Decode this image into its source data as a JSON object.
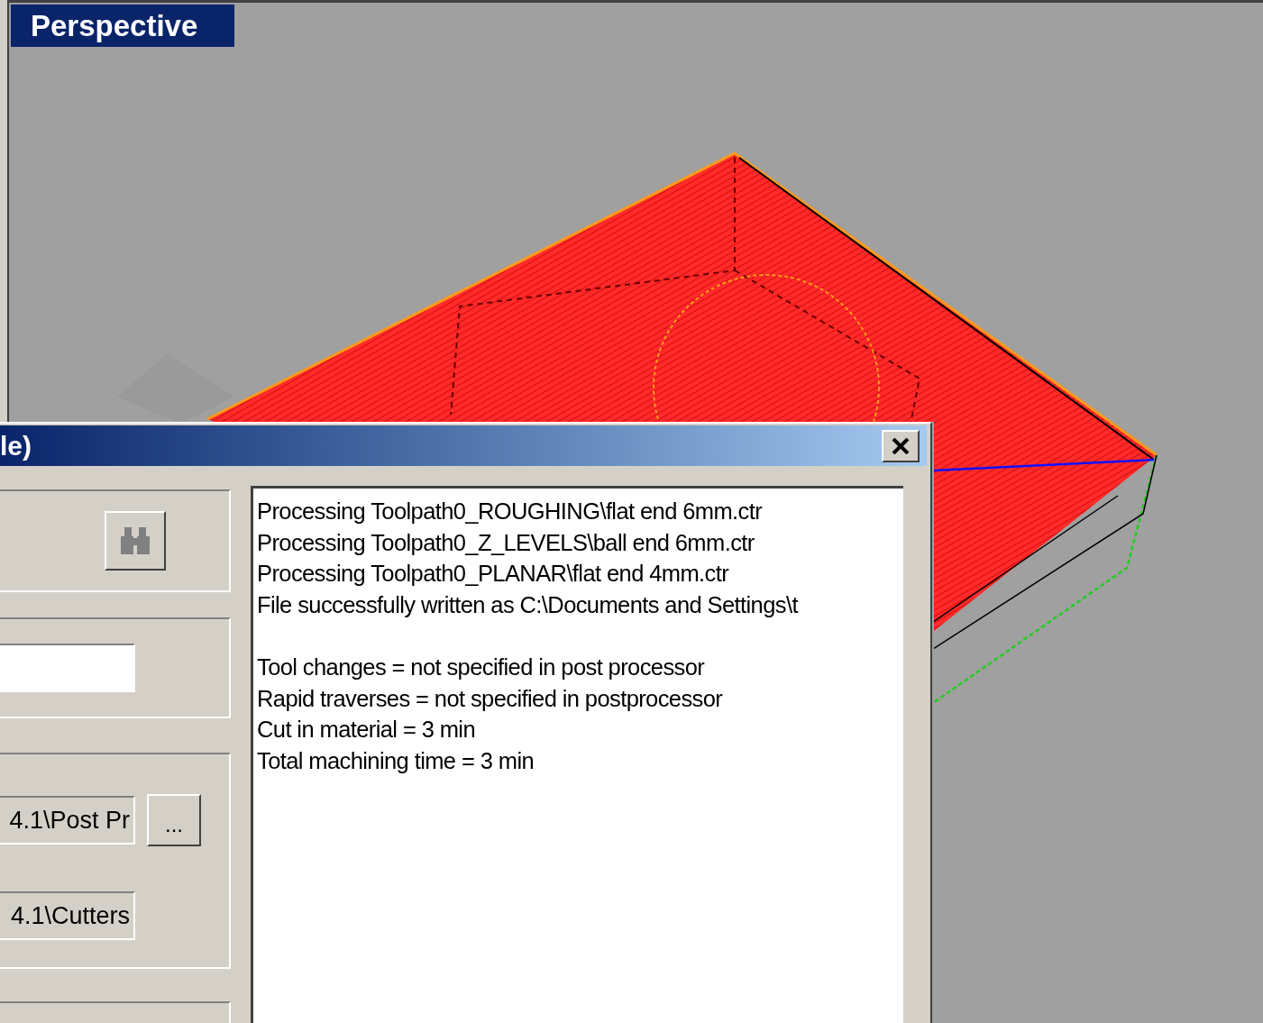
{
  "viewport": {
    "title": "Perspective"
  },
  "dialog": {
    "title": "le)",
    "left_panel": {
      "fields": [
        {
          "kind": "entry"
        },
        {
          "kind": "path",
          "value": "4.1\\Post Pr"
        },
        {
          "kind": "path",
          "value": "4.1\\Cutters"
        }
      ],
      "browse_button": "..."
    },
    "log": {
      "blocks": [
        [
          "Processing Toolpath0_ROUGHING\\flat end 6mm.ctr",
          "Processing Toolpath0_Z_LEVELS\\ball end 6mm.ctr",
          "Processing Toolpath0_PLANAR\\flat end 4mm.ctr",
          "File successfully written as C:\\Documents and Settings\\t"
        ],
        [
          "Tool changes = not specified in post processor",
          "Rapid traverses = not specified in postprocessor",
          "Cut in material = 3 min",
          "Total machining time = 3 min"
        ]
      ]
    }
  }
}
